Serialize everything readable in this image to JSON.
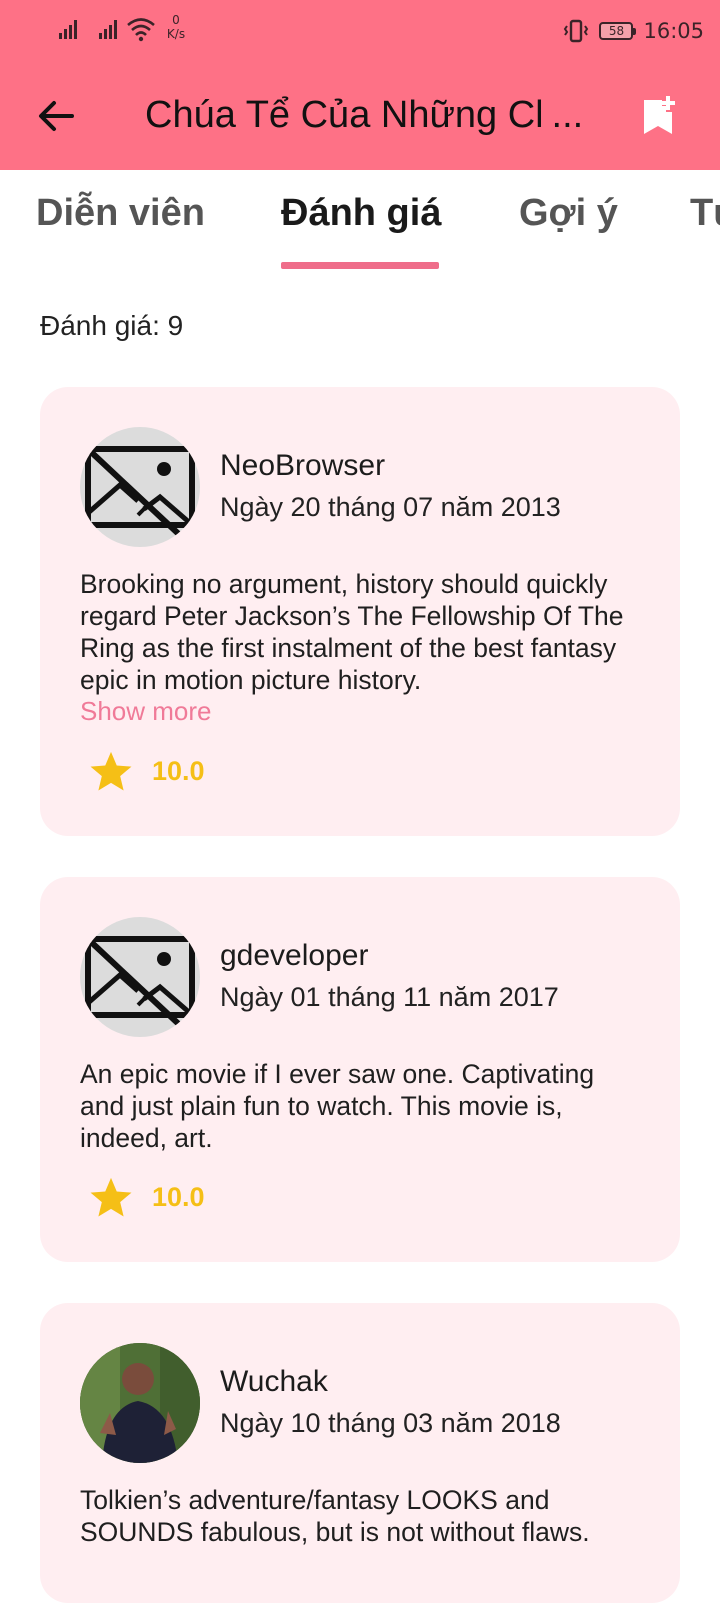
{
  "status_bar": {
    "net_speed_value": "0",
    "net_speed_unit": "K/s",
    "battery": "58",
    "time": "16:05"
  },
  "app_bar": {
    "title": "Chúa Tể Của Những Chiếc Nhẫn"
  },
  "tabs": [
    {
      "label": "Diễn viên",
      "active": false
    },
    {
      "label": "Đánh giá",
      "active": true
    },
    {
      "label": "Gợi ý",
      "active": false
    },
    {
      "label": "Tương tự",
      "active": false
    }
  ],
  "reviews_header": "Đánh giá: 9",
  "reviews": [
    {
      "author": "NeoBrowser",
      "date": "Ngày 20 tháng 07 năm 2013",
      "avatar": "broken-image-icon",
      "text": "Brooking no argument, history should quickly regard Peter Jackson’s The Fellowship Of The Ring as the first instalment of the best fantasy epic in motion picture history.",
      "show_more": "Show more",
      "rating": "10.0"
    },
    {
      "author": "gdeveloper",
      "date": "Ngày 01 tháng 11 năm 2017",
      "avatar": "broken-image-icon",
      "text": "An epic movie if I ever saw one. Captivating and just plain fun to watch. This movie is, indeed, art.",
      "rating": "10.0"
    },
    {
      "author": "Wuchak",
      "date": "Ngày 10 tháng 03 năm 2018",
      "avatar": "user-photo",
      "text": "Tolkien’s adventure/fantasy LOOKS and SOUNDS fabulous, but is not without flaws."
    }
  ],
  "colors": {
    "primary": "#fe7186",
    "card_bg": "#ffeef1",
    "accent_link": "#f07a98",
    "star": "#f5bf16",
    "tab_indicator": "#ef6d8a"
  }
}
